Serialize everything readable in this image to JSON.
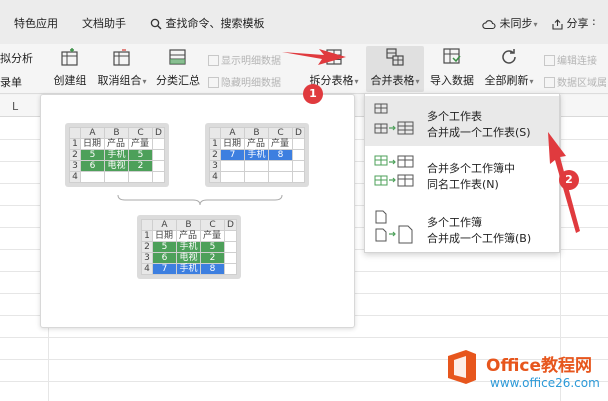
{
  "menubar": {
    "items": [
      "特色应用",
      "文档助手"
    ],
    "search_label": "查找命令、搜索模板",
    "sync_label": "未同步",
    "share_label": "分享"
  },
  "ribbon": {
    "left_partial": [
      "拟分析",
      "录单"
    ],
    "buttons": [
      {
        "label": "创建组",
        "icon": "create-group-icon"
      },
      {
        "label": "取消组合",
        "icon": "ungroup-icon",
        "caret": "▾"
      },
      {
        "label": "分类汇总",
        "icon": "subtotal-icon"
      },
      {
        "label": "拆分表格",
        "icon": "split-table-icon",
        "caret": "▾"
      },
      {
        "label": "合并表格",
        "icon": "merge-table-icon",
        "caret": "▾"
      },
      {
        "label": "导入数据",
        "icon": "import-data-icon"
      },
      {
        "label": "全部刷新",
        "icon": "refresh-all-icon",
        "caret": "▾"
      }
    ],
    "disabled": [
      "显示明细数据",
      "隐藏明细数据",
      "编辑连接",
      "数据区域属"
    ]
  },
  "sheet": {
    "column_label": "L"
  },
  "preview": {
    "table1": {
      "cols": [
        "A",
        "B",
        "C",
        "D"
      ],
      "rows": [
        [
          "1",
          "日期",
          "产品",
          "产量",
          ""
        ],
        [
          "2",
          "5",
          "手机",
          "5",
          ""
        ],
        [
          "3",
          "6",
          "电视",
          "2",
          ""
        ],
        [
          "4",
          "",
          "",
          "",
          ""
        ]
      ]
    },
    "table2": {
      "cols": [
        "A",
        "B",
        "C",
        "D"
      ],
      "rows": [
        [
          "1",
          "日期",
          "产品",
          "产量",
          ""
        ],
        [
          "2",
          "7",
          "手机",
          "8",
          ""
        ],
        [
          "3",
          "",
          "",
          "",
          ""
        ],
        [
          "4",
          "",
          "",
          "",
          ""
        ]
      ]
    },
    "table3": {
      "cols": [
        "A",
        "B",
        "C",
        "D"
      ],
      "rows": [
        [
          "1",
          "日期",
          "产品",
          "产量",
          ""
        ],
        [
          "2",
          "5",
          "手机",
          "5",
          ""
        ],
        [
          "3",
          "6",
          "电视",
          "2",
          ""
        ],
        [
          "4",
          "7",
          "手机",
          "8",
          ""
        ]
      ]
    }
  },
  "dropdown": {
    "items": [
      {
        "line1": "多个工作表",
        "line2": "合并成一个工作表(S)"
      },
      {
        "line1": "合并多个工作簿中",
        "line2": "同名工作表(N)"
      },
      {
        "line1": "多个工作簿",
        "line2": "合并成一个工作簿(B)"
      }
    ]
  },
  "annotations": {
    "badge1": "1",
    "badge2": "2"
  },
  "watermark": {
    "line1": "Office教程网",
    "line2": "www.office26.com"
  },
  "colors": {
    "green": "#4da05a",
    "blue": "#3d7fe0",
    "red": "#e03a3e",
    "orange": "#e7561d"
  }
}
